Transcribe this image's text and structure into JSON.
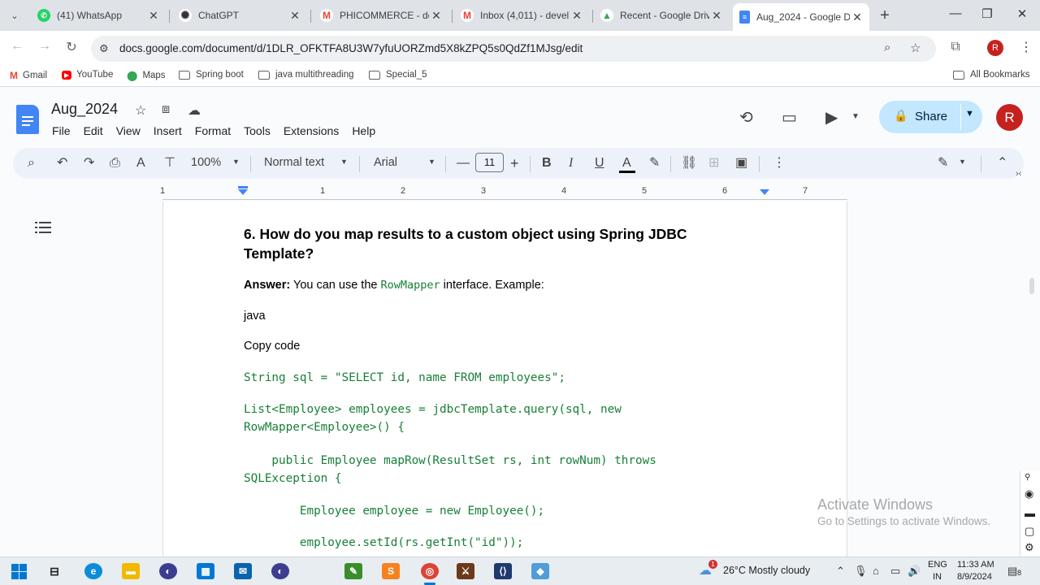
{
  "browser": {
    "tabs": [
      {
        "title": "(41) WhatsApp",
        "color": "#25d366",
        "glyph": "✆",
        "active": false
      },
      {
        "title": "ChatGPT",
        "color": "#444444",
        "glyph": "✺",
        "active": false
      },
      {
        "title": "PHICOMMERCE - dev",
        "color": "#ea4335",
        "glyph": "M",
        "active": false
      },
      {
        "title": "Inbox (4,011) - devel",
        "color": "#ea4335",
        "glyph": "M",
        "active": false
      },
      {
        "title": "Recent - Google Driv",
        "color": "#34a853",
        "glyph": "▲",
        "active": false
      },
      {
        "title": "Aug_2024 - Google D",
        "color": "#4285f4",
        "glyph": "≡",
        "active": true
      }
    ],
    "url": "docs.google.com/document/d/1DLR_OFKTFA8U3W7yfuUORZmd5X8kZPQ5s0QdZf1MJsg/edit",
    "profile_initial": "R",
    "bookmarks": [
      {
        "label": "Gmail",
        "icon": "gmail-icon"
      },
      {
        "label": "YouTube",
        "icon": "youtube-icon"
      },
      {
        "label": "Maps",
        "icon": "maps-icon"
      },
      {
        "label": "Spring boot",
        "icon": "folder-icon"
      },
      {
        "label": "java multithreading",
        "icon": "folder-icon"
      },
      {
        "label": "Special_5",
        "icon": "folder-icon"
      }
    ],
    "all_bookmarks": "All Bookmarks"
  },
  "docs": {
    "title": "Aug_2024",
    "menu": [
      "File",
      "Edit",
      "View",
      "Insert",
      "Format",
      "Tools",
      "Extensions",
      "Help"
    ],
    "share_label": "Share",
    "user_initial": "R",
    "toolbar": {
      "zoom": "100%",
      "style": "Normal text",
      "font": "Arial",
      "font_size": "11"
    },
    "ruler_numbers": [
      "1",
      "1",
      "2",
      "3",
      "4",
      "5",
      "6",
      "7"
    ]
  },
  "document": {
    "heading": "6. How do you map results to a custom object using Spring JDBC Template?",
    "answer_label": "Answer:",
    "answer_pre": " You can use the ",
    "answer_code": "RowMapper",
    "answer_post": " interface. Example:",
    "lang": "java",
    "copy_code": "Copy code",
    "code_lines": [
      "String sql = \"SELECT id, name FROM employees\";",
      "List<Employee> employees = jdbcTemplate.query(sql, new",
      "RowMapper<Employee>() {",
      "    public Employee mapRow(ResultSet rs, int rowNum) throws",
      "SQLException {",
      "        Employee employee = new Employee();",
      "        employee.setId(rs.getInt(\"id\"));"
    ]
  },
  "watermark": {
    "line1": "Activate Windows",
    "line2": "Go to Settings to activate Windows."
  },
  "taskbar": {
    "weather": "26°C  Mostly cloudy",
    "weather_badge": "1",
    "lang_top": "ENG",
    "lang_bottom": "IN",
    "time": "11:33 AM",
    "date": "8/9/2024",
    "notifications": "8"
  },
  "colors": {
    "docs_blue": "#4285f4",
    "share_bg": "#c2e7ff",
    "code_green": "#188038",
    "avatar_red": "#c5221f"
  }
}
